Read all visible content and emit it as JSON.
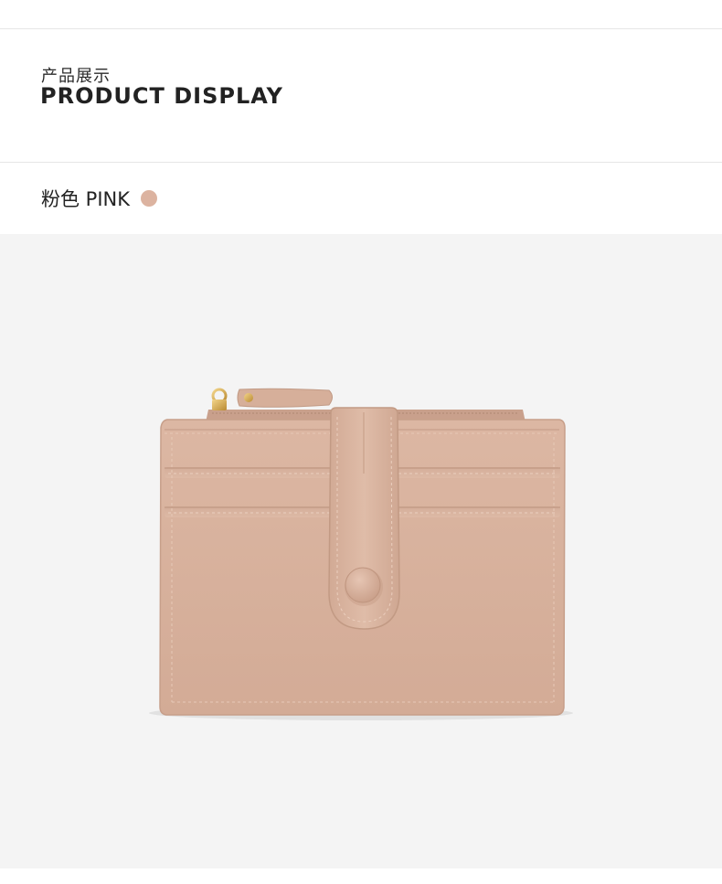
{
  "header": {
    "title_cn": "产品展示",
    "title_en": "PRODUCT DISPLAY"
  },
  "variant": {
    "label": "粉色 PINK",
    "swatch_color": "#dcb3a0"
  },
  "product_image": {
    "icon": "wallet-icon",
    "wallet_color": "#d9b4a0",
    "background_color": "#f4f4f4"
  }
}
